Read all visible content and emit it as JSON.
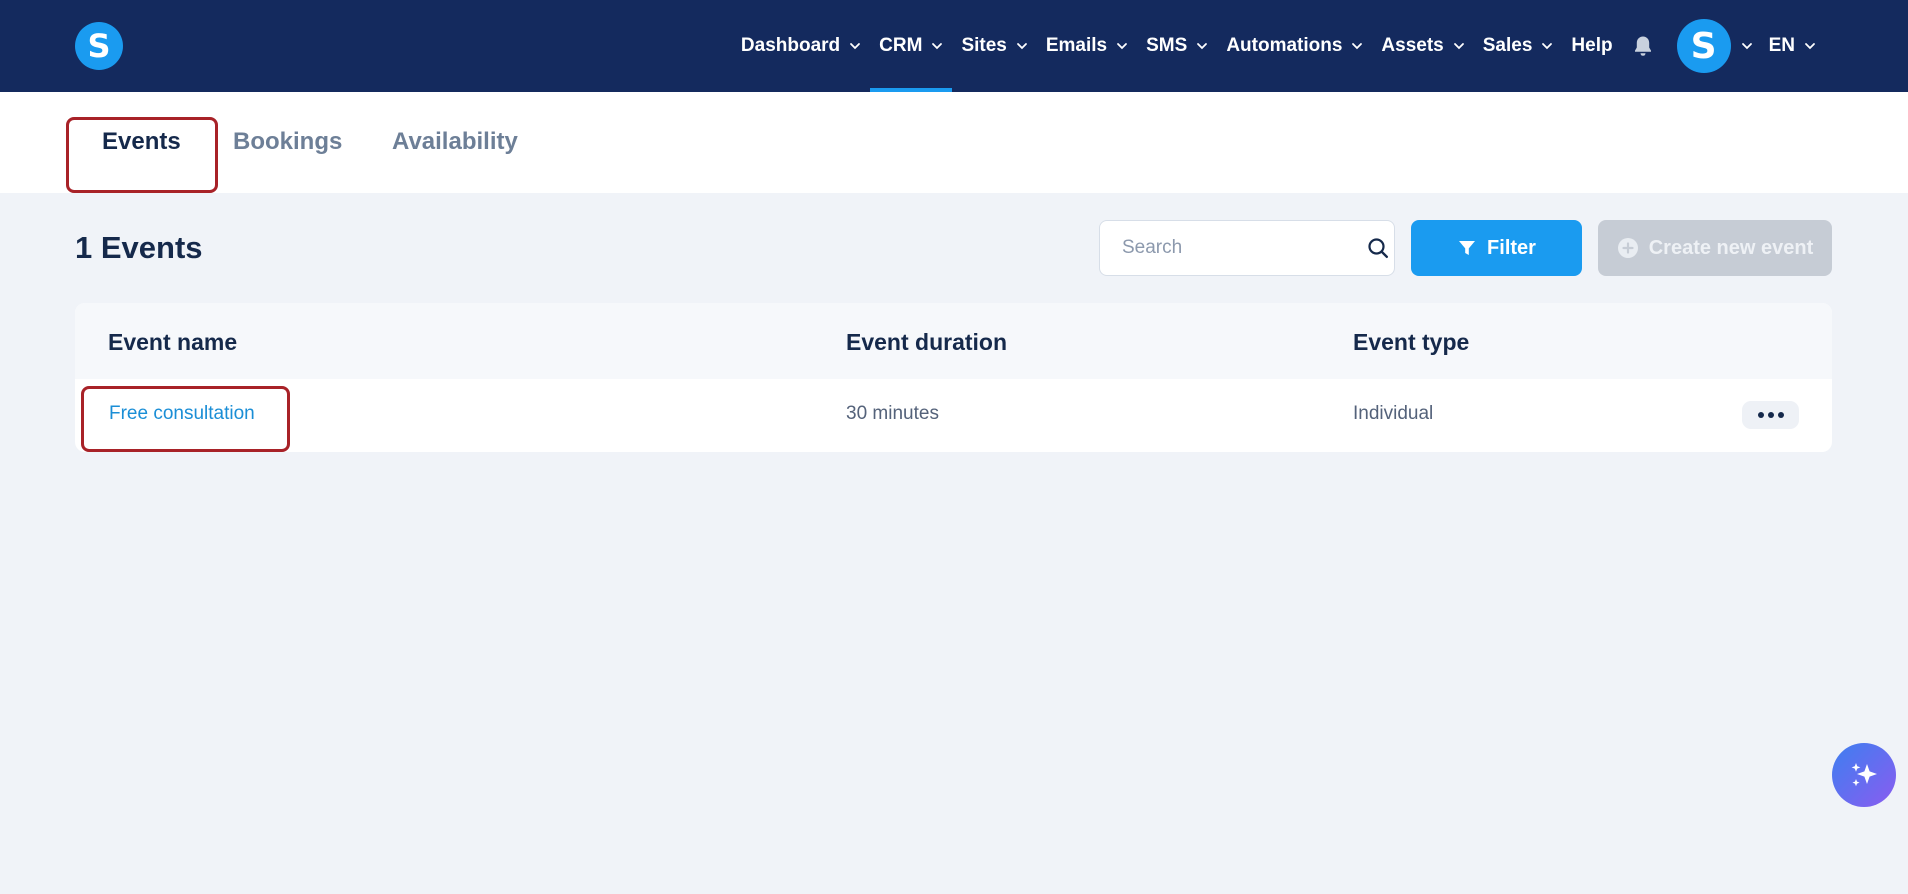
{
  "nav": {
    "items": [
      {
        "label": "Dashboard",
        "dropdown": true
      },
      {
        "label": "CRM",
        "dropdown": true,
        "active": true
      },
      {
        "label": "Sites",
        "dropdown": true
      },
      {
        "label": "Emails",
        "dropdown": true
      },
      {
        "label": "SMS",
        "dropdown": true
      },
      {
        "label": "Automations",
        "dropdown": true
      },
      {
        "label": "Assets",
        "dropdown": true
      },
      {
        "label": "Sales",
        "dropdown": true
      },
      {
        "label": "Help",
        "dropdown": false
      }
    ],
    "lang": "EN",
    "logo_letter": "S",
    "avatar_letter": "S"
  },
  "tabs": [
    {
      "label": "Events",
      "active": true
    },
    {
      "label": "Bookings"
    },
    {
      "label": "Availability"
    }
  ],
  "header": {
    "title": "1 Events",
    "search_placeholder": "Search",
    "filter_label": "Filter",
    "create_label": "Create new event"
  },
  "table": {
    "columns": [
      "Event name",
      "Event duration",
      "Event type"
    ],
    "rows": [
      {
        "name": "Free consultation",
        "duration": "30 minutes",
        "type": "Individual"
      }
    ]
  },
  "colors": {
    "nav_bg": "#142a5e",
    "accent": "#1a9bf0",
    "highlight": "#a82228"
  }
}
